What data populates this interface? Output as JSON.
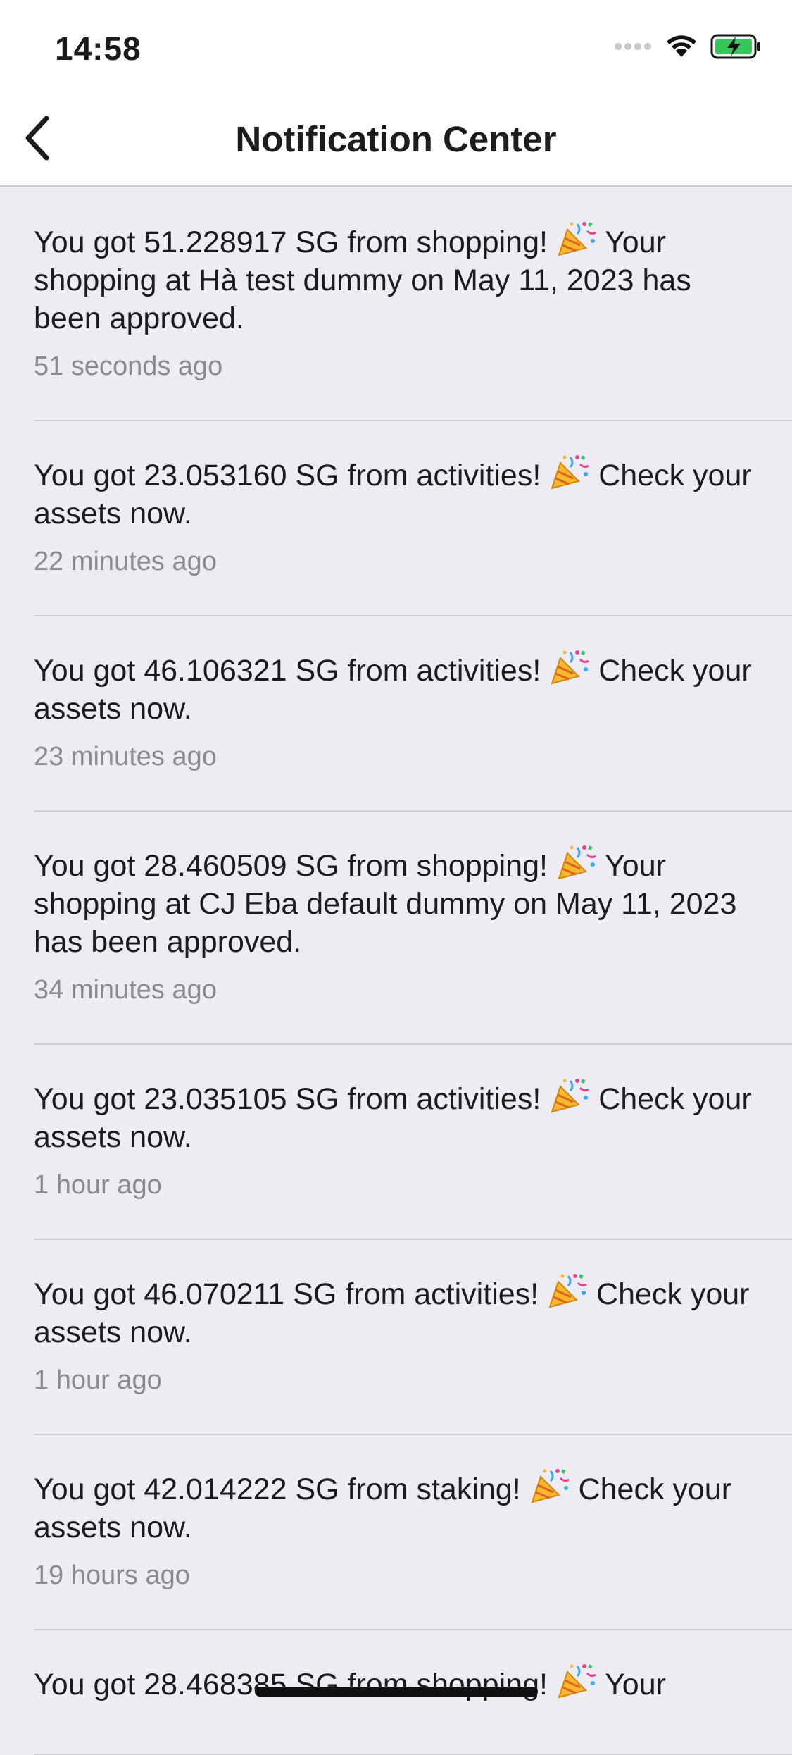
{
  "status_bar": {
    "time": "14:58",
    "icons": [
      "signal-dots-icon",
      "wifi-icon",
      "battery-charging-icon"
    ],
    "battery_color": "#34c759"
  },
  "nav": {
    "back_icon": "chevron-left-icon",
    "title": "Notification Center"
  },
  "notifications": [
    {
      "before": "You got 51.228917 SG from shopping! ",
      "emoji": "party-popper-icon",
      "after": " Your shopping at Hà test dummy on May 11, 2023 has been approved.",
      "time": "51 seconds ago"
    },
    {
      "before": "You got 23.053160 SG from activities! ",
      "emoji": "party-popper-icon",
      "after": " Check your assets now.",
      "time": "22 minutes ago"
    },
    {
      "before": "You got 46.106321 SG from activities! ",
      "emoji": "party-popper-icon",
      "after": " Check your assets now.",
      "time": "23 minutes ago"
    },
    {
      "before": "You got 28.460509 SG from shopping! ",
      "emoji": "party-popper-icon",
      "after": " Your shopping at CJ Eba default dummy on May 11, 2023 has been approved.",
      "time": "34 minutes ago"
    },
    {
      "before": "You got 23.035105 SG from activities! ",
      "emoji": "party-popper-icon",
      "after": " Check your assets now.",
      "time": "1 hour ago"
    },
    {
      "before": "You got 46.070211 SG from activities! ",
      "emoji": "party-popper-icon",
      "after": " Check your assets now.",
      "time": "1 hour ago"
    },
    {
      "before": "You got 42.014222 SG from staking! ",
      "emoji": "party-popper-icon",
      "after": " Check your assets now.",
      "time": "19 hours ago"
    },
    {
      "before": "You got 28.468385 SG from shopping! ",
      "emoji": "party-popper-icon",
      "after": " Your",
      "time": ""
    }
  ]
}
